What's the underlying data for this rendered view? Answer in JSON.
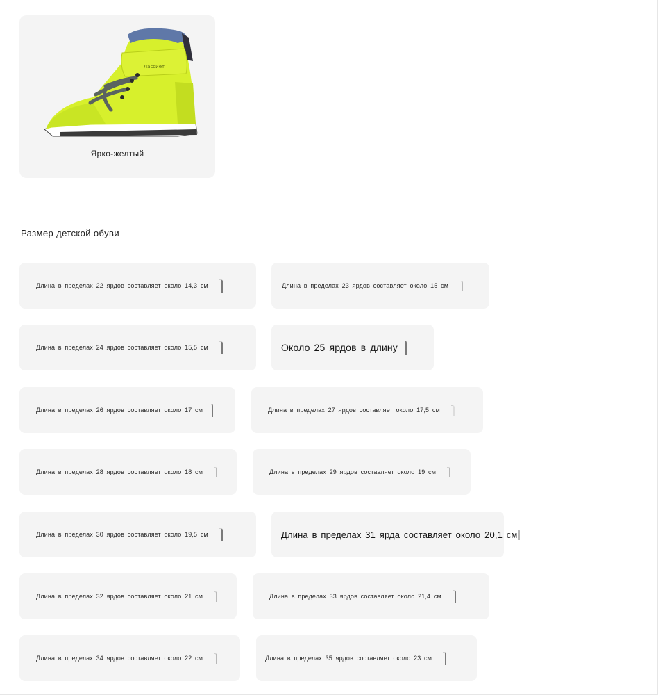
{
  "color_option": {
    "label": "Ярко-желтый",
    "brand_text": "Лассиет",
    "swatch": "#d7f02c"
  },
  "size_section": {
    "title": "Размер детской обуви"
  },
  "sizes": [
    "Длина в пределах 22 ярдов составляет около 14,3 см",
    "Длина в пределах 23 ярдов составляет около 15 см",
    "Длина в пределах 24 ярдов составляет около 15,5 см",
    "Около 25 ярдов в длину",
    "Длина в пределах 26 ярдов составляет около 17 см",
    "Длина в пределах 27 ярдов составляет около 17,5 см",
    "Длина в пределах 28 ярдов составляет около 18 см",
    "Длина в пределах 29 ярдов составляет около 19 см",
    "Длина в пределах 30 ярдов составляет около 19,5 см",
    "Длина в пределах 31 ярда составляет около 20,1 см",
    "Длина в пределах 32 ярдов составляет около 21 см",
    "Длина в пределах 33 ярдов составляет около 21,4 см",
    "Длина в пределах 34 ярдов составляет около 22 см",
    "Длина в пределах 35 ярдов составляет около 23 см"
  ]
}
